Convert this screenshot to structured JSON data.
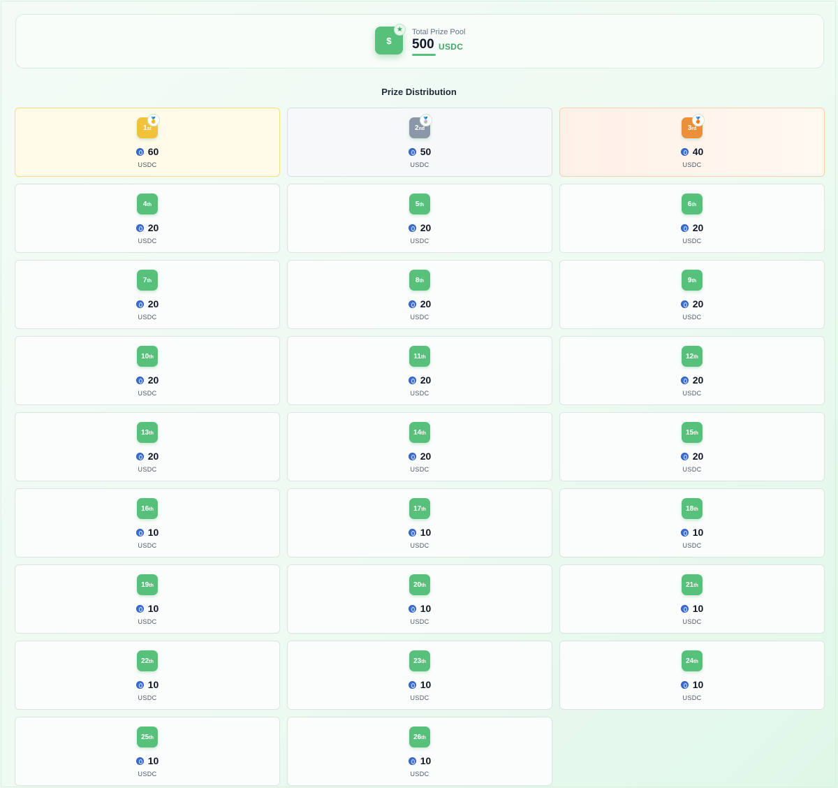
{
  "pool": {
    "icon_symbol": "$",
    "badge_icon": "star-icon",
    "label": "Total Prize Pool",
    "amount": "500",
    "currency": "USDC"
  },
  "section_title": "Prize Distribution",
  "accent_color": "#57c17b",
  "prizes": [
    {
      "num": "1",
      "suffix": "st",
      "amount": "60",
      "currency": "USDC",
      "tier": "gold",
      "medal": "gold-medal-icon"
    },
    {
      "num": "2",
      "suffix": "nd",
      "amount": "50",
      "currency": "USDC",
      "tier": "silver",
      "medal": "silver-medal-icon"
    },
    {
      "num": "3",
      "suffix": "rd",
      "amount": "40",
      "currency": "USDC",
      "tier": "bronze",
      "medal": "bronze-medal-icon"
    },
    {
      "num": "4",
      "suffix": "th",
      "amount": "20",
      "currency": "USDC",
      "tier": "standard"
    },
    {
      "num": "5",
      "suffix": "th",
      "amount": "20",
      "currency": "USDC",
      "tier": "standard"
    },
    {
      "num": "6",
      "suffix": "th",
      "amount": "20",
      "currency": "USDC",
      "tier": "standard"
    },
    {
      "num": "7",
      "suffix": "th",
      "amount": "20",
      "currency": "USDC",
      "tier": "standard"
    },
    {
      "num": "8",
      "suffix": "th",
      "amount": "20",
      "currency": "USDC",
      "tier": "standard"
    },
    {
      "num": "9",
      "suffix": "th",
      "amount": "20",
      "currency": "USDC",
      "tier": "standard"
    },
    {
      "num": "10",
      "suffix": "th",
      "amount": "20",
      "currency": "USDC",
      "tier": "standard"
    },
    {
      "num": "11",
      "suffix": "th",
      "amount": "20",
      "currency": "USDC",
      "tier": "standard"
    },
    {
      "num": "12",
      "suffix": "th",
      "amount": "20",
      "currency": "USDC",
      "tier": "standard"
    },
    {
      "num": "13",
      "suffix": "th",
      "amount": "20",
      "currency": "USDC",
      "tier": "standard"
    },
    {
      "num": "14",
      "suffix": "th",
      "amount": "20",
      "currency": "USDC",
      "tier": "standard"
    },
    {
      "num": "15",
      "suffix": "th",
      "amount": "20",
      "currency": "USDC",
      "tier": "standard"
    },
    {
      "num": "16",
      "suffix": "th",
      "amount": "10",
      "currency": "USDC",
      "tier": "standard"
    },
    {
      "num": "17",
      "suffix": "th",
      "amount": "10",
      "currency": "USDC",
      "tier": "standard"
    },
    {
      "num": "18",
      "suffix": "th",
      "amount": "10",
      "currency": "USDC",
      "tier": "standard"
    },
    {
      "num": "19",
      "suffix": "th",
      "amount": "10",
      "currency": "USDC",
      "tier": "standard"
    },
    {
      "num": "20",
      "suffix": "th",
      "amount": "10",
      "currency": "USDC",
      "tier": "standard"
    },
    {
      "num": "21",
      "suffix": "th",
      "amount": "10",
      "currency": "USDC",
      "tier": "standard"
    },
    {
      "num": "22",
      "suffix": "th",
      "amount": "10",
      "currency": "USDC",
      "tier": "standard"
    },
    {
      "num": "23",
      "suffix": "th",
      "amount": "10",
      "currency": "USDC",
      "tier": "standard"
    },
    {
      "num": "24",
      "suffix": "th",
      "amount": "10",
      "currency": "USDC",
      "tier": "standard"
    },
    {
      "num": "25",
      "suffix": "th",
      "amount": "10",
      "currency": "USDC",
      "tier": "standard"
    },
    {
      "num": "26",
      "suffix": "th",
      "amount": "10",
      "currency": "USDC",
      "tier": "standard"
    }
  ]
}
